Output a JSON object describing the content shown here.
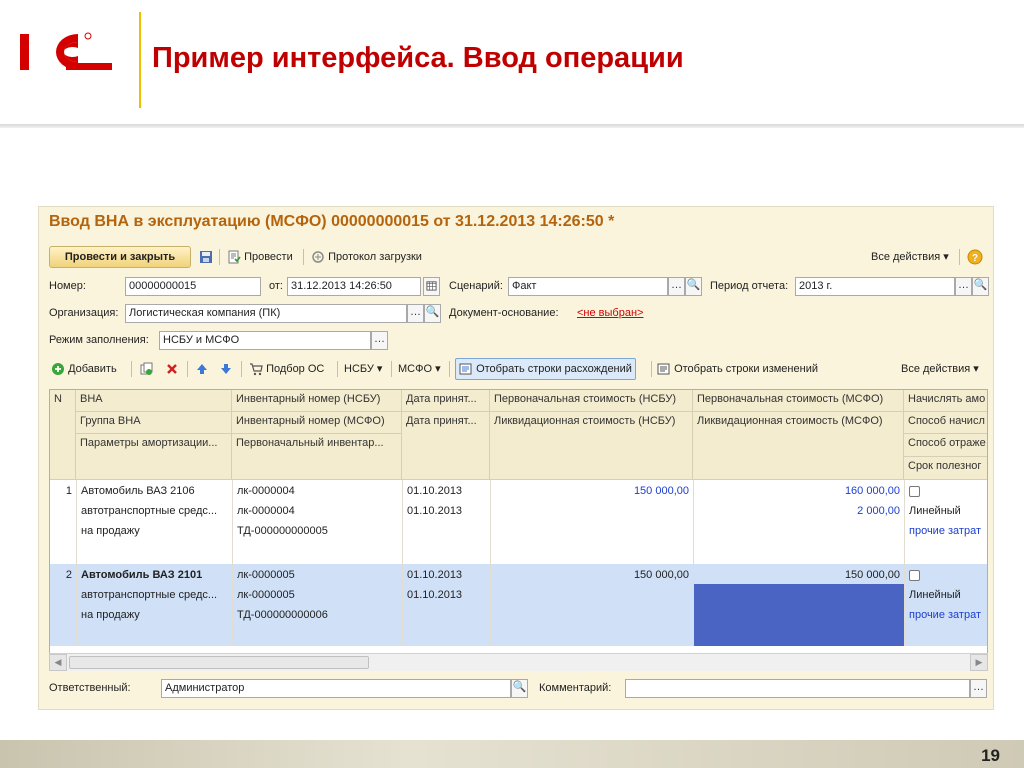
{
  "slide": {
    "title": "Пример интерфейса. Ввод операции",
    "page_number": "19",
    "brand_color": "#c00000"
  },
  "window": {
    "title": "Ввод ВНА в эксплуатацию (МСФО) 00000000015 от 31.12.2013 14:26:50 *",
    "toolbar": {
      "post_close": "Провести и закрыть",
      "post": "Провести",
      "protocol": "Протокол загрузки",
      "all_actions": "Все действия ▾"
    },
    "form": {
      "number_label": "Номер:",
      "number_value": "00000000015",
      "date_label": "от:",
      "date_value": "31.12.2013 14:26:50",
      "scenario_label": "Сценарий:",
      "scenario_value": "Факт",
      "period_label": "Период отчета:",
      "period_value": "2013 г.",
      "org_label": "Организация:",
      "org_value": "Логистическая компания (ПК)",
      "basis_label": "Документ-основание:",
      "basis_value": "<не выбран>",
      "mode_label": "Режим заполнения:",
      "mode_value": "НСБУ и МСФО"
    },
    "table_toolbar": {
      "add": "Добавить",
      "select_os": "Подбор ОС",
      "nsbu": "НСБУ ▾",
      "msfo": "МСФО ▾",
      "show_diff": "Отобрать строки расхождений",
      "show_changes": "Отобрать строки изменений",
      "all_actions": "Все действия ▾"
    },
    "columns": [
      [
        "N"
      ],
      [
        "ВНА",
        "Группа ВНА",
        "Параметры амортизации..."
      ],
      [
        "Инвентарный номер (НСБУ)",
        "Инвентарный номер (МСФО)",
        "Первоначальный инвентар..."
      ],
      [
        "Дата принят...",
        "Дата принят..."
      ],
      [
        "Первоначальная стоимость (НСБУ)",
        "Ликвидационная стоимость (НСБУ)"
      ],
      [
        "Первоначальная стоимость (МСФО)",
        "Ликвидационная стоимость (МСФО)"
      ],
      [
        "Начислять амо",
        "Способ начисл",
        "Способ отраже",
        "Срок полезног"
      ]
    ],
    "rows": [
      {
        "n": "1",
        "asset": "Автомобиль ВАЗ 2106",
        "group": "автотранспортные средс...",
        "amort": "на продажу",
        "inv_nsbu": "лк-0000004",
        "inv_msfo": "лк-0000004",
        "inv_initial": "ТД-000000000005",
        "date1": "01.10.2013",
        "date2": "01.10.2013",
        "cost_nsbu": "150 000,00",
        "liq_nsbu": "",
        "cost_msfo": "160 000,00",
        "liq_msfo": "2 000,00",
        "method": "Линейный",
        "reflect": "прочие затрат"
      },
      {
        "n": "2",
        "asset": "Автомобиль ВАЗ 2101",
        "group": "автотранспортные средс...",
        "amort": "на продажу",
        "inv_nsbu": "лк-0000005",
        "inv_msfo": "лк-0000005",
        "inv_initial": "ТД-000000000006",
        "date1": "01.10.2013",
        "date2": "01.10.2013",
        "cost_nsbu": "150 000,00",
        "liq_nsbu": "",
        "cost_msfo": "150 000,00",
        "liq_msfo": "",
        "method": "Линейный",
        "reflect": "прочие затрат"
      }
    ],
    "bottom": {
      "responsible_label": "Ответственный:",
      "responsible_value": "Администратор",
      "comment_label": "Комментарий:",
      "comment_value": ""
    }
  },
  "colors": {
    "window_bg": "#faf4dc",
    "title": "#b5640e",
    "selected_row": "#cfe0f7",
    "selected_cell": "#4a64c4",
    "link": "#d00000"
  }
}
